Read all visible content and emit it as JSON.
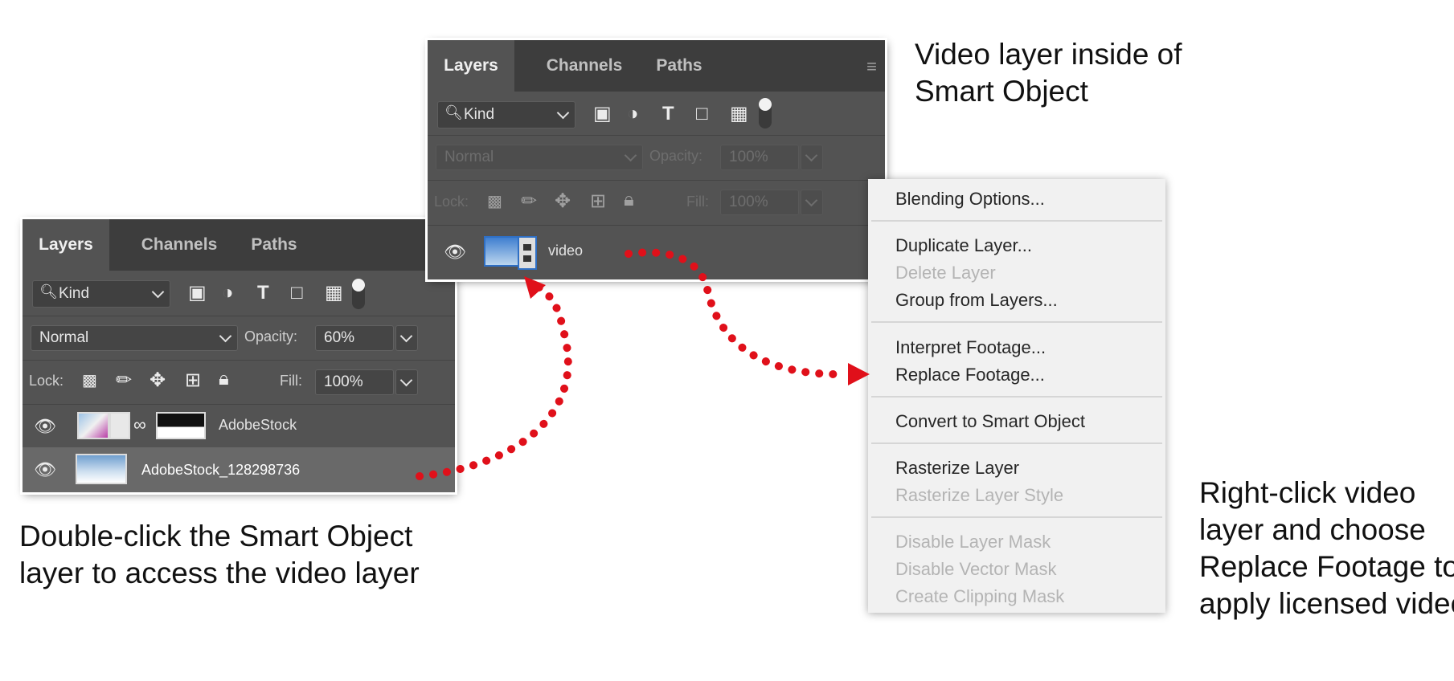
{
  "annotations": {
    "top_caption": [
      "Video layer inside of",
      "Smart Object"
    ],
    "left_caption": [
      "Double-click the Smart Object",
      "layer to access the video layer"
    ],
    "right_caption": [
      "Right-click video",
      "layer and choose",
      "Replace Footage to",
      "apply licensed video"
    ]
  },
  "panel_left": {
    "tabs": [
      "Layers",
      "Channels",
      "Paths"
    ],
    "kind_label": "Kind",
    "blend_mode": "Normal",
    "opacity_label": "Opacity:",
    "opacity_value": "60%",
    "lock_label": "Lock:",
    "fill_label": "Fill:",
    "fill_value": "100%",
    "layers": [
      {
        "name": "AdobeStock",
        "visible": true,
        "selected": false
      },
      {
        "name": "AdobeStock_128298736",
        "visible": true,
        "selected": true
      }
    ]
  },
  "panel_top": {
    "tabs": [
      "Layers",
      "Channels",
      "Paths"
    ],
    "kind_label": "Kind",
    "blend_mode": "Normal",
    "opacity_label": "Opacity:",
    "opacity_value": "100%",
    "lock_label": "Lock:",
    "fill_label": "Fill:",
    "fill_value": "100%",
    "layers": [
      {
        "name": "video",
        "visible": true,
        "selected": false
      }
    ]
  },
  "context_menu": {
    "items": [
      {
        "label": "Blending Options...",
        "enabled": true
      },
      {
        "label": "Duplicate Layer...",
        "enabled": true
      },
      {
        "label": "Delete Layer",
        "enabled": false
      },
      {
        "label": "Group from Layers...",
        "enabled": true
      },
      {
        "label": "Interpret Footage...",
        "enabled": true
      },
      {
        "label": "Replace Footage...",
        "enabled": true
      },
      {
        "label": "Convert to Smart Object",
        "enabled": true
      },
      {
        "label": "Rasterize Layer",
        "enabled": true
      },
      {
        "label": "Rasterize Layer Style",
        "enabled": false
      },
      {
        "label": "Disable Layer Mask",
        "enabled": false
      },
      {
        "label": "Disable Vector Mask",
        "enabled": false
      },
      {
        "label": "Create Clipping Mask",
        "enabled": false
      }
    ]
  },
  "colors": {
    "panel_bg": "#535353",
    "tabbar_bg": "#3d3d3d",
    "arrow": "#e0101a",
    "menu_bg": "#f1f1f1"
  }
}
